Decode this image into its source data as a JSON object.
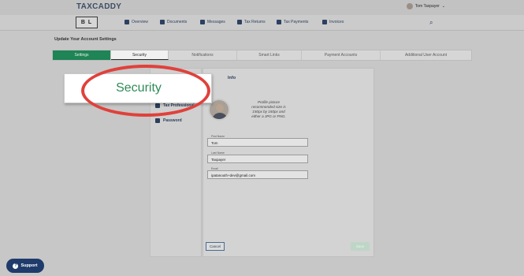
{
  "brand": {
    "logo": "TAXCADDY",
    "initials": "B L"
  },
  "user": {
    "name": "Tom Taxpayer",
    "caret": "⌄"
  },
  "nav": {
    "items": [
      {
        "label": "Overview",
        "icon": "home-icon"
      },
      {
        "label": "Documents",
        "icon": "documents-icon"
      },
      {
        "label": "Messages",
        "icon": "messages-icon"
      },
      {
        "label": "Tax Returns",
        "icon": "tax-returns-icon"
      },
      {
        "label": "Tax Payments",
        "icon": "tax-payments-icon"
      },
      {
        "label": "Invoices",
        "icon": "invoices-icon"
      }
    ],
    "search_glyph": "⌕"
  },
  "page": {
    "title": "Update Your Account Settings"
  },
  "tabs": [
    {
      "label": "Settings"
    },
    {
      "label": "Security"
    },
    {
      "label": "Notifications"
    },
    {
      "label": "Smart Links"
    },
    {
      "label": "Payment Accounts"
    },
    {
      "label": "Additional User Account"
    }
  ],
  "sidebar": {
    "items": [
      {
        "label": "Tax Professional",
        "icon": "briefcase-icon"
      },
      {
        "label": "Password",
        "icon": "lock-icon"
      }
    ]
  },
  "profile": {
    "title_partial": "Info",
    "hint": "Profile picture recommended size is 150px by 150px and either a JPG or PNG.",
    "fields": [
      {
        "label": "First Name",
        "value": "Tom"
      },
      {
        "label": "Last Name",
        "value": "Taxpayer"
      },
      {
        "label": "Email",
        "value": "ipatanouth+dev@gmail.com"
      }
    ],
    "cancel_label": "Cancel",
    "save_label": "Save"
  },
  "callout": {
    "text": "Security"
  },
  "support": {
    "label": "Support",
    "glyph": "?"
  },
  "colors": {
    "accent_green": "#1f8456",
    "navy": "#1e3b6b",
    "highlight_ring": "#e0413b"
  }
}
